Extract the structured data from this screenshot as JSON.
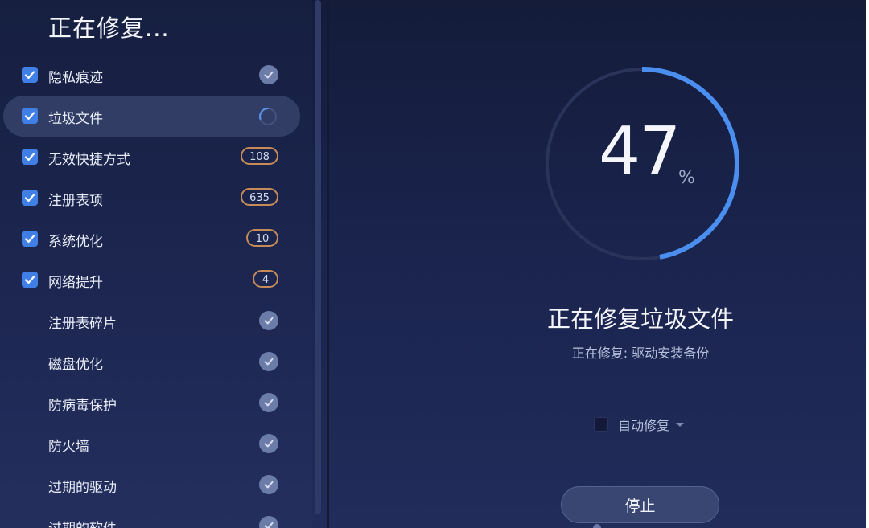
{
  "sidebar": {
    "title": "正在修复...",
    "items": [
      {
        "label": "隐私痕迹",
        "checked": true,
        "state": "done"
      },
      {
        "label": "垃圾文件",
        "checked": true,
        "state": "in-progress",
        "active": true
      },
      {
        "label": "无效快捷方式",
        "checked": true,
        "state": "count",
        "count": "108"
      },
      {
        "label": "注册表项",
        "checked": true,
        "state": "count",
        "count": "635"
      },
      {
        "label": "系统优化",
        "checked": true,
        "state": "count",
        "count": "10"
      },
      {
        "label": "网络提升",
        "checked": true,
        "state": "count",
        "count": "4"
      },
      {
        "label": "注册表碎片",
        "checked": false,
        "state": "done"
      },
      {
        "label": "磁盘优化",
        "checked": false,
        "state": "done"
      },
      {
        "label": "防病毒保护",
        "checked": false,
        "state": "done"
      },
      {
        "label": "防火墙",
        "checked": false,
        "state": "done"
      },
      {
        "label": "过期的驱动",
        "checked": false,
        "state": "done"
      },
      {
        "label": "过期的软件",
        "checked": false,
        "state": "done"
      }
    ]
  },
  "main": {
    "progress": {
      "value": "47",
      "unit": "%",
      "fraction": 0.47
    },
    "status_title": "正在修复垃圾文件",
    "status_sub": "正在修复: 驱动安装备份",
    "auto_fix_label": "自动修复",
    "stop_label": "停止"
  },
  "colors": {
    "accent": "#4a8ef0",
    "badge_border": "#c68b58",
    "background": "#1b2550"
  }
}
